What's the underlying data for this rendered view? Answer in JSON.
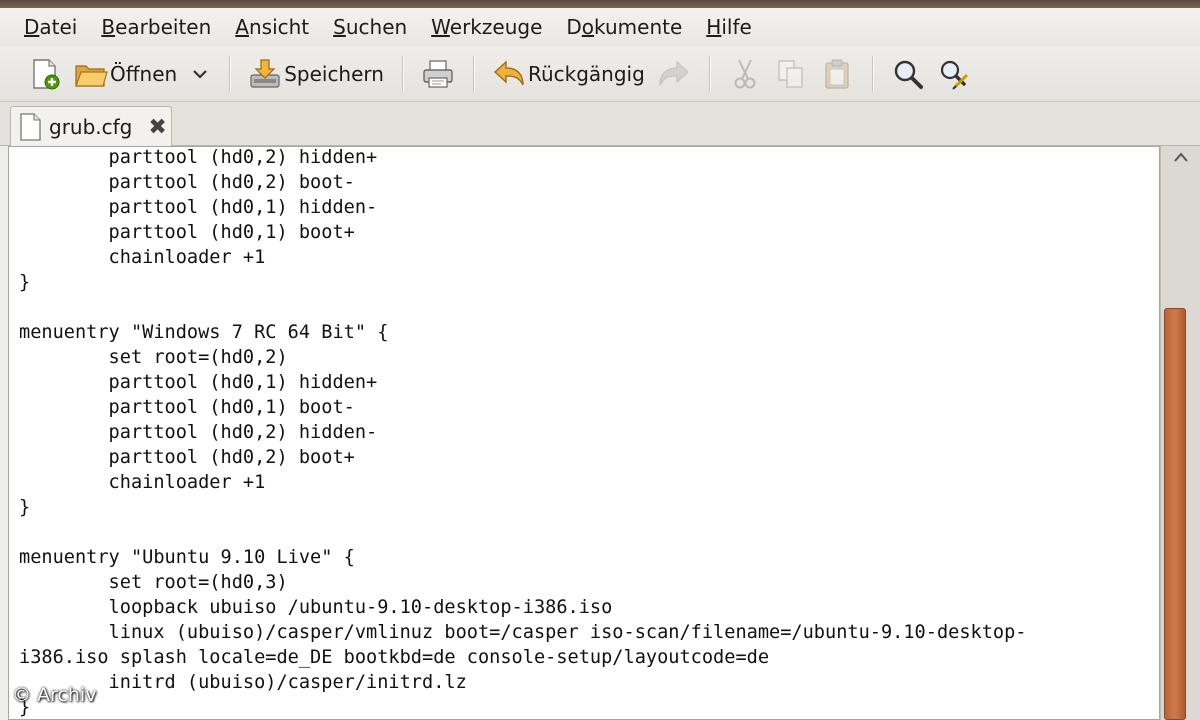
{
  "menu": {
    "items": [
      {
        "accel": "D",
        "rest": "atei"
      },
      {
        "accel": "B",
        "rest": "earbeiten"
      },
      {
        "accel": "A",
        "rest": "nsicht"
      },
      {
        "accel": "S",
        "rest": "uchen"
      },
      {
        "accel": "W",
        "rest": "erkzeuge"
      },
      {
        "pre": "D",
        "accel": "o",
        "rest": "kumente"
      },
      {
        "accel": "H",
        "rest": "ilfe"
      }
    ]
  },
  "toolbar": {
    "open_label": "Öffnen",
    "save_label": "Speichern",
    "undo_label": "Rückgängig"
  },
  "tab": {
    "label": "grub.cfg",
    "close_glyph": "✖"
  },
  "editor": {
    "lines": [
      "        parttool (hd0,2) hidden+",
      "        parttool (hd0,2) boot-",
      "        parttool (hd0,1) hidden-",
      "        parttool (hd0,1) boot+",
      "        chainloader +1",
      "}",
      "",
      "menuentry \"Windows 7 RC 64 Bit\" {",
      "        set root=(hd0,2)",
      "        parttool (hd0,1) hidden+",
      "        parttool (hd0,1) boot-",
      "        parttool (hd0,2) hidden-",
      "        parttool (hd0,2) boot+",
      "        chainloader +1",
      "}",
      "",
      "menuentry \"Ubuntu 9.10 Live\" {",
      "        set root=(hd0,3)",
      "        loopback ubuiso /ubuntu-9.10-desktop-i386.iso",
      "        linux (ubuiso)/casper/vmlinuz boot=/casper iso-scan/filename=/ubuntu-9.10-desktop-",
      "i386.iso splash locale=de_DE bootkbd=de console-setup/layoutcode=de",
      "        initrd (ubuiso)/casper/initrd.lz",
      "}"
    ]
  },
  "watermark": "© Archiv",
  "colors": {
    "scroll_thumb": "#c56d40",
    "window_bg": "#eeeeec"
  }
}
